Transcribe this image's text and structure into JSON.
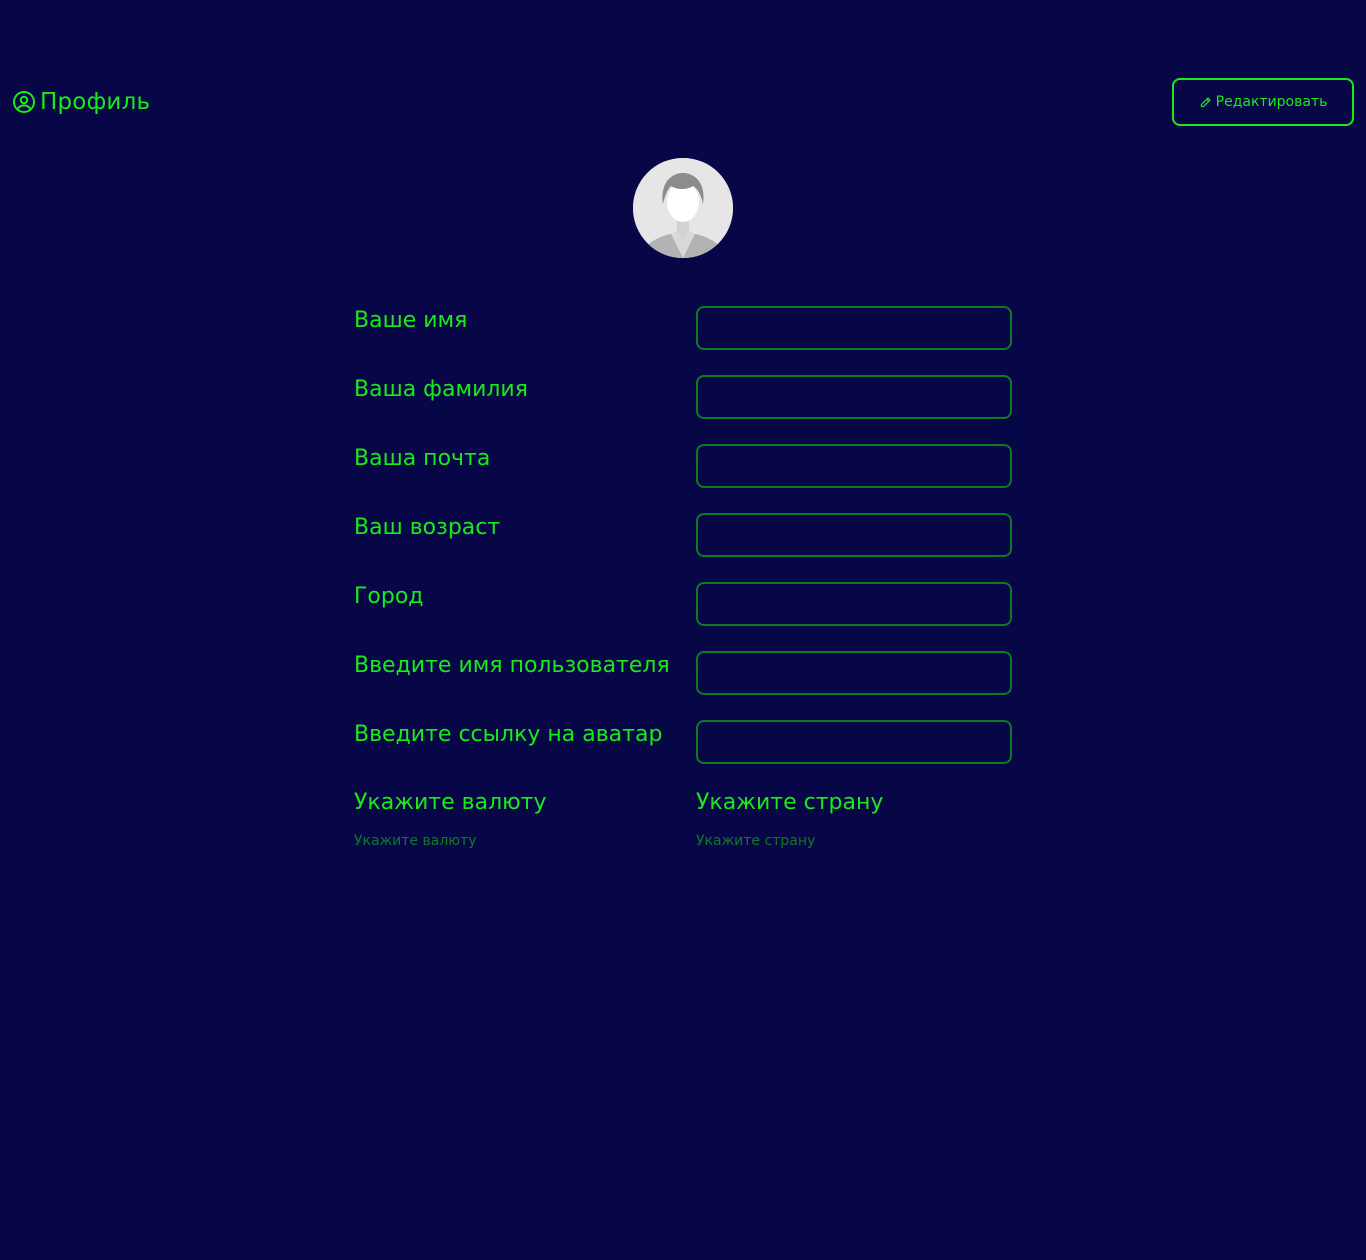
{
  "header": {
    "title": "Профиль",
    "title_icon": "user-circle-icon",
    "edit_button_label": "Редактировать",
    "edit_button_icon": "pencil-icon"
  },
  "avatar": {
    "icon": "avatar-placeholder"
  },
  "form": {
    "fields": [
      {
        "label": "Ваше имя",
        "value": ""
      },
      {
        "label": "Ваша фамилия",
        "value": ""
      },
      {
        "label": "Ваша почта",
        "value": ""
      },
      {
        "label": "Ваш возраст",
        "value": ""
      },
      {
        "label": "Город",
        "value": ""
      },
      {
        "label": "Введите имя пользователя",
        "value": ""
      },
      {
        "label": "Введите ссылку на аватар",
        "value": ""
      }
    ],
    "currency": {
      "label": "Укажите валюту",
      "value": "Укажите валюту"
    },
    "country": {
      "label": "Укажите страну",
      "value": "Укажите страну"
    }
  },
  "colors": {
    "background": "#070748",
    "accent": "#19ea19",
    "input_border": "#0e7a26",
    "muted": "#0f7a26"
  }
}
